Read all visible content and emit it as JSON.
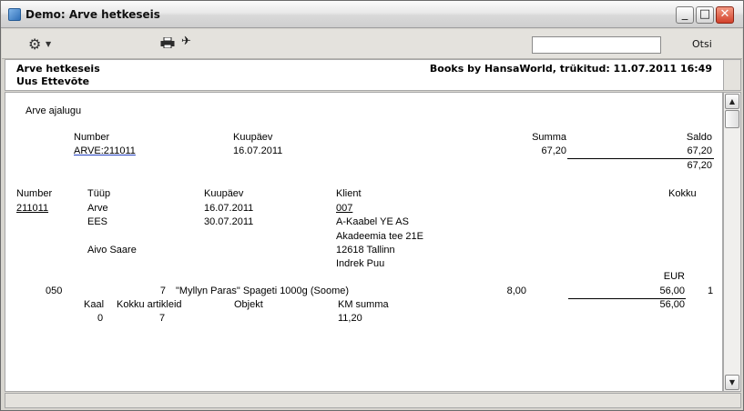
{
  "window": {
    "title": "Demo: Arve hetkeseis"
  },
  "toolbar": {
    "gear_icon": "gear-icon",
    "print_icon": "printer-icon",
    "pin_icon": "pin-icon",
    "search_value": "",
    "search_button": "Otsi"
  },
  "header": {
    "report_name": "Arve hetkeseis",
    "company": "Uus Ettevõte",
    "printed_by": "Books by HansaWorld, trükitud: 11.07.2011 16:49"
  },
  "history": {
    "section_title": "Arve ajalugu",
    "col_number": "Number",
    "col_date": "Kuupäev",
    "col_sum": "Summa",
    "col_balance": "Saldo",
    "row_number": "ARVE:211011",
    "row_date": "16.07.2011",
    "row_sum": "67,20",
    "row_balance": "67,20",
    "total_balance": "67,20"
  },
  "invoice": {
    "col_number": "Number",
    "col_type": "Tüüp",
    "col_date": "Kuupäev",
    "col_customer": "Klient",
    "col_total": "Kokku",
    "number": "211011",
    "type1": "Arve",
    "date1": "16.07.2011",
    "customer_code": "007",
    "type2": "EES",
    "date2": "30.07.2011",
    "customer_name": "A-Kaabel YE AS",
    "address1": "Akadeemia tee 21E",
    "salesman": "Aivo Saare",
    "address2": "12618 Tallinn",
    "contact": "Indrek Puu"
  },
  "line": {
    "currency": "EUR",
    "code": "050",
    "qty": "7",
    "description": "\"Myllyn Paras\" Spageti 1000g  (Soome)",
    "unit_price": "8,00",
    "amount": "56,00",
    "vat_code": "1",
    "total": "56,00",
    "col_weight": "Kaal",
    "col_item_total": "Kokku artikleid",
    "col_object": "Objekt",
    "col_vat_sum": "KM summa",
    "weight": "0",
    "item_total": "7",
    "vat_sum": "11,20"
  }
}
